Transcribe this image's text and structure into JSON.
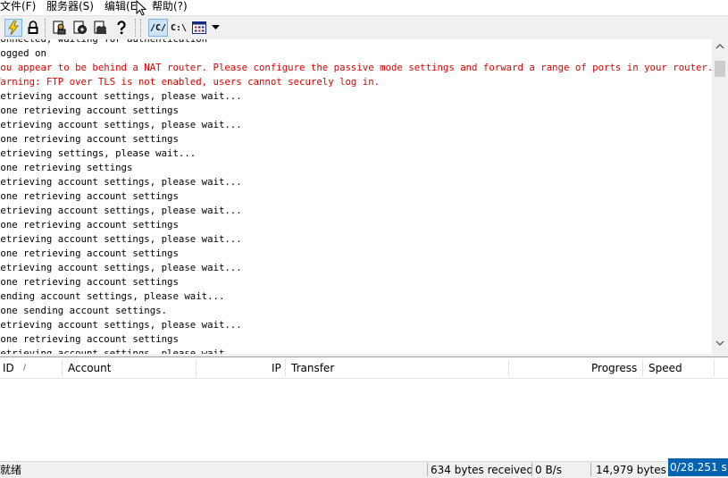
{
  "menu": {
    "file": "文件(F)",
    "server": "服务器(S)",
    "edit": "编辑(E",
    "help": "帮助(?)"
  },
  "toolbar": {
    "path_slash": "/C/",
    "path_backslash": "C:\\",
    "buttons": [
      "lightning-icon",
      "lock-icon",
      "users-icon",
      "gear-icon",
      "group-icon",
      "help-icon",
      "path-slash",
      "path-backslash",
      "grid-icon",
      "dropdown-arrow"
    ]
  },
  "log": {
    "lines": [
      {
        "text": "Connected, waiting for authentication",
        "color": "black"
      },
      {
        "text": "Logged on",
        "color": "black"
      },
      {
        "text": "You appear to be behind a NAT router. Please configure the passive mode settings and forward a range of ports in your router.",
        "color": "red"
      },
      {
        "text": "Warning: FTP over TLS is not enabled, users cannot securely log in.",
        "color": "red"
      },
      {
        "text": "Retrieving account settings, please wait...",
        "color": "black"
      },
      {
        "text": "Done retrieving account settings",
        "color": "black"
      },
      {
        "text": "Retrieving account settings, please wait...",
        "color": "black"
      },
      {
        "text": "Done retrieving account settings",
        "color": "black"
      },
      {
        "text": "Retrieving settings, please wait...",
        "color": "black"
      },
      {
        "text": "Done retrieving settings",
        "color": "black"
      },
      {
        "text": "Retrieving account settings, please wait...",
        "color": "black"
      },
      {
        "text": "Done retrieving account settings",
        "color": "black"
      },
      {
        "text": "Retrieving account settings, please wait...",
        "color": "black"
      },
      {
        "text": "Done retrieving account settings",
        "color": "black"
      },
      {
        "text": "Retrieving account settings, please wait...",
        "color": "black"
      },
      {
        "text": "Done retrieving account settings",
        "color": "black"
      },
      {
        "text": "Retrieving account settings, please wait...",
        "color": "black"
      },
      {
        "text": "Done retrieving account settings",
        "color": "black"
      },
      {
        "text": "Sending account settings, please wait...",
        "color": "black"
      },
      {
        "text": "Done sending account settings.",
        "color": "black"
      },
      {
        "text": "Retrieving account settings, please wait...",
        "color": "black"
      },
      {
        "text": "Done retrieving account settings",
        "color": "black"
      },
      {
        "text": "Retrieving account settings, please wait...",
        "color": "black"
      }
    ],
    "colors": {
      "black": "#000000",
      "red": "#e00000"
    }
  },
  "table": {
    "columns": {
      "id": "ID",
      "sort_indicator": "/",
      "account": "Account",
      "ip": "IP",
      "transfer": "Transfer",
      "progress": "Progress",
      "speed": "Speed"
    }
  },
  "status": {
    "ready": "就绪",
    "received": "634 bytes received",
    "recv_rate": "0 B/s",
    "sent": "14,979 bytes s",
    "overlay": "0/28.251 s"
  },
  "theme": {
    "accent": "#0063b1",
    "toolbar_active": "#cce4f7"
  }
}
